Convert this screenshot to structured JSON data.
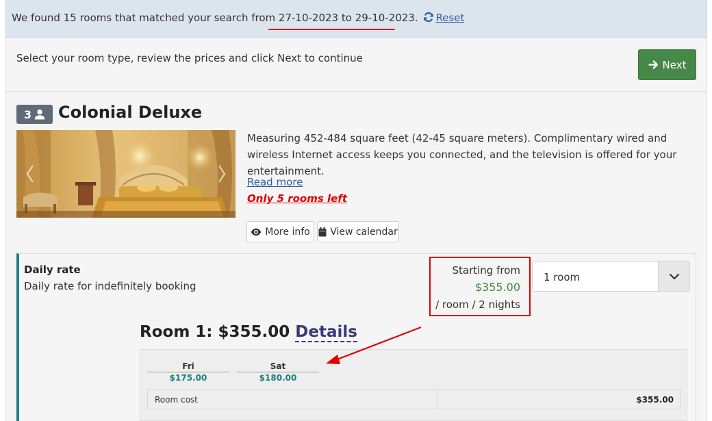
{
  "search_alert": {
    "prefix": "We found 15 rooms that matched your search from",
    "date_range": "27-10-2023 to 29-10-2023",
    "suffix": ".",
    "reset_label": "Reset",
    "reset_icon": "refresh-icon"
  },
  "toolbar": {
    "instructions": "Select your room type, review the prices and click Next to continue",
    "next_label": "Next",
    "next_icon": "arrow-right-icon"
  },
  "room": {
    "occupancy": "3",
    "occupancy_icon": "user-icon",
    "name": "Colonial Deluxe",
    "description": "Measuring 452-484 square feet (42-45 square meters). Complimentary wired and wireless Internet access keeps you connected, and the television is offered for your entertainment.",
    "read_more": "Read more",
    "availability": "Only 5 rooms left",
    "more_info_label": "More info",
    "view_calendar_label": "View calendar"
  },
  "rate": {
    "name": "Daily rate",
    "description": "Daily rate for indefinitely booking",
    "starting_from": "Starting from",
    "price": "$355.00",
    "per": "/ room / 2 nights",
    "room_select_value": "1 room"
  },
  "breakdown": {
    "room_title": "Room 1: $355.00",
    "details_label": "Details",
    "days": [
      {
        "day": "Fri",
        "price": "$175.00"
      },
      {
        "day": "Sat",
        "price": "$180.00"
      }
    ],
    "cost_label": "Room cost",
    "cost_value": "$355.00"
  },
  "colors": {
    "accent_green": "#468847",
    "price_green": "#3c8c3c",
    "teal": "#1e7e7e",
    "annotation_red": "#e00000",
    "link_blue": "#2d5fa3"
  }
}
